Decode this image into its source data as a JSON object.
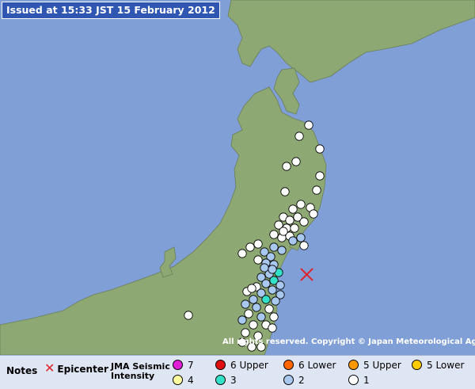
{
  "issued": "Issued at 15:33 JST  15 February 2012",
  "copyright": "All rights reserved. Copyright © Japan Meteorological Agency",
  "legend": {
    "notes": "Notes",
    "epicenter": "Epicenter",
    "intensity_title_1": "JMA Seismic",
    "intensity_title_2": "Intensity",
    "levels": [
      {
        "label": "7",
        "color": "#e020d8"
      },
      {
        "label": "6 Upper",
        "color": "#e01010"
      },
      {
        "label": "6 Lower",
        "color": "#ff6600"
      },
      {
        "label": "5 Upper",
        "color": "#ff9900"
      },
      {
        "label": "5 Lower",
        "color": "#ffcc00"
      },
      {
        "label": "4",
        "color": "#ffffa0"
      },
      {
        "label": "3",
        "color": "#33e0c8"
      },
      {
        "label": "2",
        "color": "#a8c8f0"
      },
      {
        "label": "1",
        "color": "#ffffff"
      }
    ]
  },
  "colors": {
    "sea": "#7f9fd6",
    "land": "#8ea873",
    "epicenter": "#e0232a"
  }
}
